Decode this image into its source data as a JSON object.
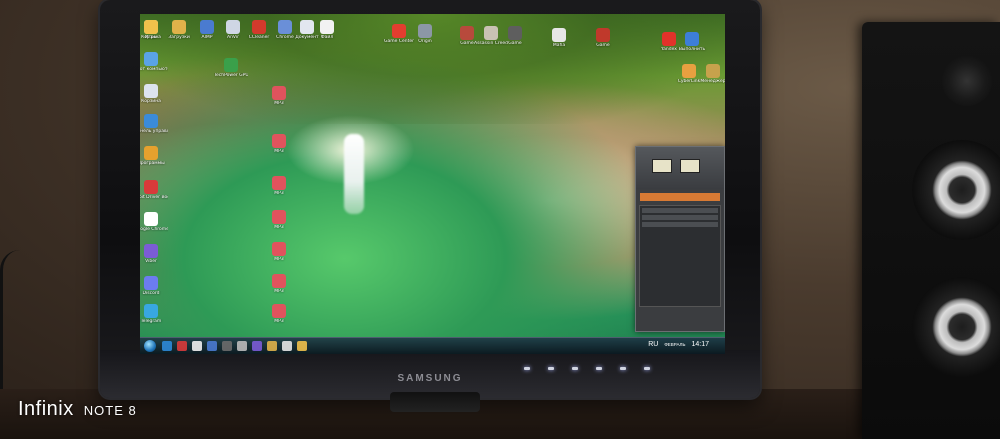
{
  "photo": {
    "watermark": {
      "brand": "Infinix",
      "model": "NOTE 8"
    },
    "monitor": {
      "brand": "SAMSUNG"
    }
  },
  "desktop": {
    "left_icons": [
      {
        "label": "Корзина",
        "color": "#cfd6e4"
      },
      {
        "label": "Этот компьютер",
        "color": "#5aa3e6"
      },
      {
        "label": "Корзина",
        "color": "#dde3ee"
      },
      {
        "label": "Панель управления",
        "color": "#3b8bd9"
      },
      {
        "label": "Программы",
        "color": "#e6a12e"
      },
      {
        "label": "IObit Driver Booster",
        "color": "#d83a3a"
      },
      {
        "label": "Google Chrome",
        "color": "#ffffff"
      },
      {
        "label": "Viber",
        "color": "#7b5cd6"
      },
      {
        "label": "Discord",
        "color": "#6c7cf0"
      },
      {
        "label": "Telegram",
        "color": "#38a7e0"
      }
    ],
    "top_icons": [
      {
        "label": "Игры",
        "color": "#f0c14b"
      },
      {
        "label": "Загрузки",
        "color": "#e0b24a"
      },
      {
        "label": "AIMP",
        "color": "#4a7bd0"
      },
      {
        "label": "AnVir",
        "color": "#cfd6e4"
      },
      {
        "label": "CCleaner",
        "color": "#d33a2c"
      },
      {
        "label": "Chrome",
        "color": "#6a8fd8"
      },
      {
        "label": "Документ",
        "color": "#e2e6ef"
      },
      {
        "label": "Файл",
        "color": "#f2f2f2"
      },
      {
        "label": "Game Center",
        "color": "#e33d2f"
      },
      {
        "label": "Origin",
        "color": "#8c97a6"
      },
      {
        "label": "Game",
        "color": "#b84a3c"
      },
      {
        "label": "Assassin Creed",
        "color": "#c9c2b3"
      },
      {
        "label": "Game",
        "color": "#5e5e5e"
      },
      {
        "label": "Mafia",
        "color": "#e6e6e6"
      },
      {
        "label": "Game",
        "color": "#c0392b"
      }
    ],
    "mid_icons": [
      {
        "label": "TechPower GPU-Z",
        "color": "#3aa04a"
      },
      {
        "label": "MP3",
        "color": "#e0535d"
      },
      {
        "label": "MP3",
        "color": "#e0535d"
      },
      {
        "label": "MP3",
        "color": "#e0535d"
      },
      {
        "label": "MP3",
        "color": "#e0535d"
      },
      {
        "label": "MP3",
        "color": "#e0535d"
      },
      {
        "label": "MP3",
        "color": "#e0535d"
      },
      {
        "label": "MP3",
        "color": "#e0535d"
      }
    ],
    "right_icons": [
      {
        "label": "Yandex",
        "color": "#e2322a"
      },
      {
        "label": "Выполнить",
        "color": "#3d7ed8"
      },
      {
        "label": "CyberLink",
        "color": "#e8a040"
      },
      {
        "label": "Менеджер",
        "color": "#c7a24c"
      }
    ]
  },
  "taskbar": {
    "language": "RU",
    "time": "14:17",
    "date_label": "ФЕВРАЛЬ",
    "items": [
      "#2d8ad8",
      "#d83b3b",
      "#f1f1f1",
      "#4a7bd0",
      "#6b6b6b",
      "#bbbbbb",
      "#7b5cd6",
      "#e0b24a",
      "#e6e6e6",
      "#f0c14b"
    ]
  },
  "player": {
    "title": "AIMP"
  }
}
